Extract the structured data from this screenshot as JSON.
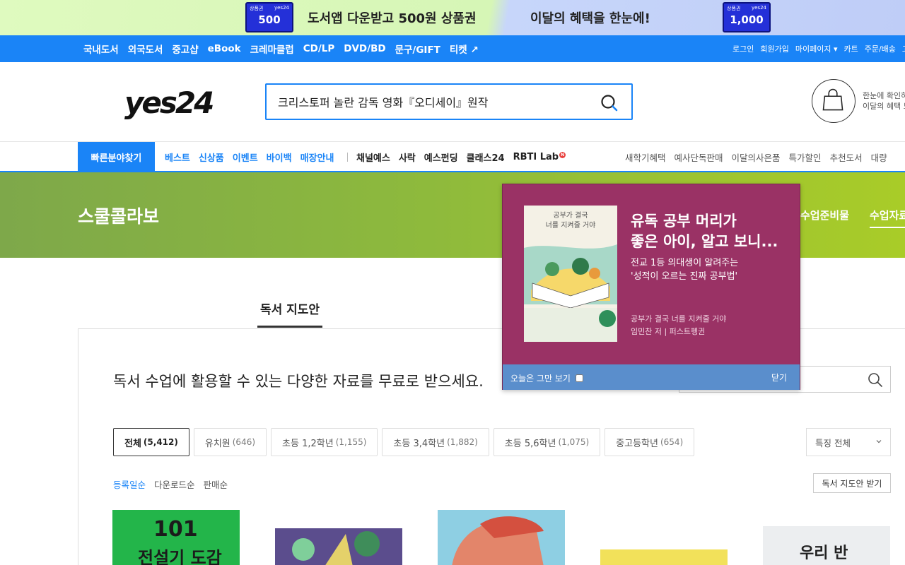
{
  "promo": {
    "voucher_left": {
      "label": "상품권",
      "brand": "yes24",
      "value": "500"
    },
    "text_left": "도서앱 다운받고 500원 상품권",
    "text_right": "이달의 혜택을 한눈에!",
    "voucher_right": {
      "label": "상품권",
      "brand": "yes24",
      "value": "1,000"
    }
  },
  "gnb": {
    "categories": [
      "국내도서",
      "외국도서",
      "중고샵",
      "eBook",
      "크레마클럽",
      "CD/LP",
      "DVD/BD",
      "문구/GIFT",
      "티켓 ↗"
    ],
    "util": [
      "로그인",
      "회원가입",
      "마이페이지 ▾",
      "카트",
      "주문/배송",
      "고"
    ]
  },
  "header": {
    "logo": "yes24",
    "search_value": "크리스토퍼 놀란 감독 영화『오디세이』원작",
    "cart_text": [
      "한눈에 확인하",
      "이달의 혜택 모"
    ]
  },
  "subnav": {
    "quick": "빠른분야찾기",
    "blue": [
      "베스트",
      "신상품",
      "이벤트",
      "바이백",
      "매장안내"
    ],
    "dark": [
      "채널예스",
      "사락",
      "예스펀딩",
      "클래스24",
      "RBTI Lab"
    ],
    "new_badge": "N",
    "right": [
      "새학기혜택",
      "예사단독판매",
      "이달의사은품",
      "특가할인",
      "추천도서",
      "대량"
    ]
  },
  "hero": {
    "title": "스쿨콜라보",
    "tab_prep": "수업준비물",
    "tab_material": "수업자료"
  },
  "main": {
    "tab": "독서 지도안",
    "headline": "독서 수업에 활용할 수 있는 다양한 자료를 무료로 받으세요.",
    "filters": [
      {
        "label": "전체",
        "count": "(5,412)",
        "active": true
      },
      {
        "label": "유치원",
        "count": "(646)"
      },
      {
        "label": "초등 1,2학년",
        "count": "(1,155)"
      },
      {
        "label": "초등 3,4학년",
        "count": "(1,882)"
      },
      {
        "label": "초등 5,6학년",
        "count": "(1,075)"
      },
      {
        "label": "중고등학년",
        "count": "(654)"
      }
    ],
    "special_select": "특징 전체",
    "sorts": [
      "등록일순",
      "다운로드순",
      "판매순"
    ],
    "guide_button": "독서 지도안 받기",
    "book1_title": "101",
    "book1_sub": "전설기 도감",
    "book5_title": "우리 반"
  },
  "popup": {
    "cover_title": [
      "공부가 결국",
      "너를 지켜줄 거야"
    ],
    "title": [
      "유독 공부 머리가",
      "좋은 아이, 알고 보니..."
    ],
    "subtitle": [
      "전교 1등 의대생이 알려주는",
      "'성적이 오르는 진짜 공부법'"
    ],
    "book_name": "공부가 결국 너를 지켜줄 거야",
    "author": "임민찬 저 | 퍼스트펭귄",
    "dont_show": "오늘은 그만 보기",
    "close": "닫기"
  },
  "colors": {
    "brand_blue": "#1a84f7",
    "popup_bg": "#9a3265",
    "popup_footer": "#5a8ecc",
    "hero_green": "#8db93d"
  }
}
